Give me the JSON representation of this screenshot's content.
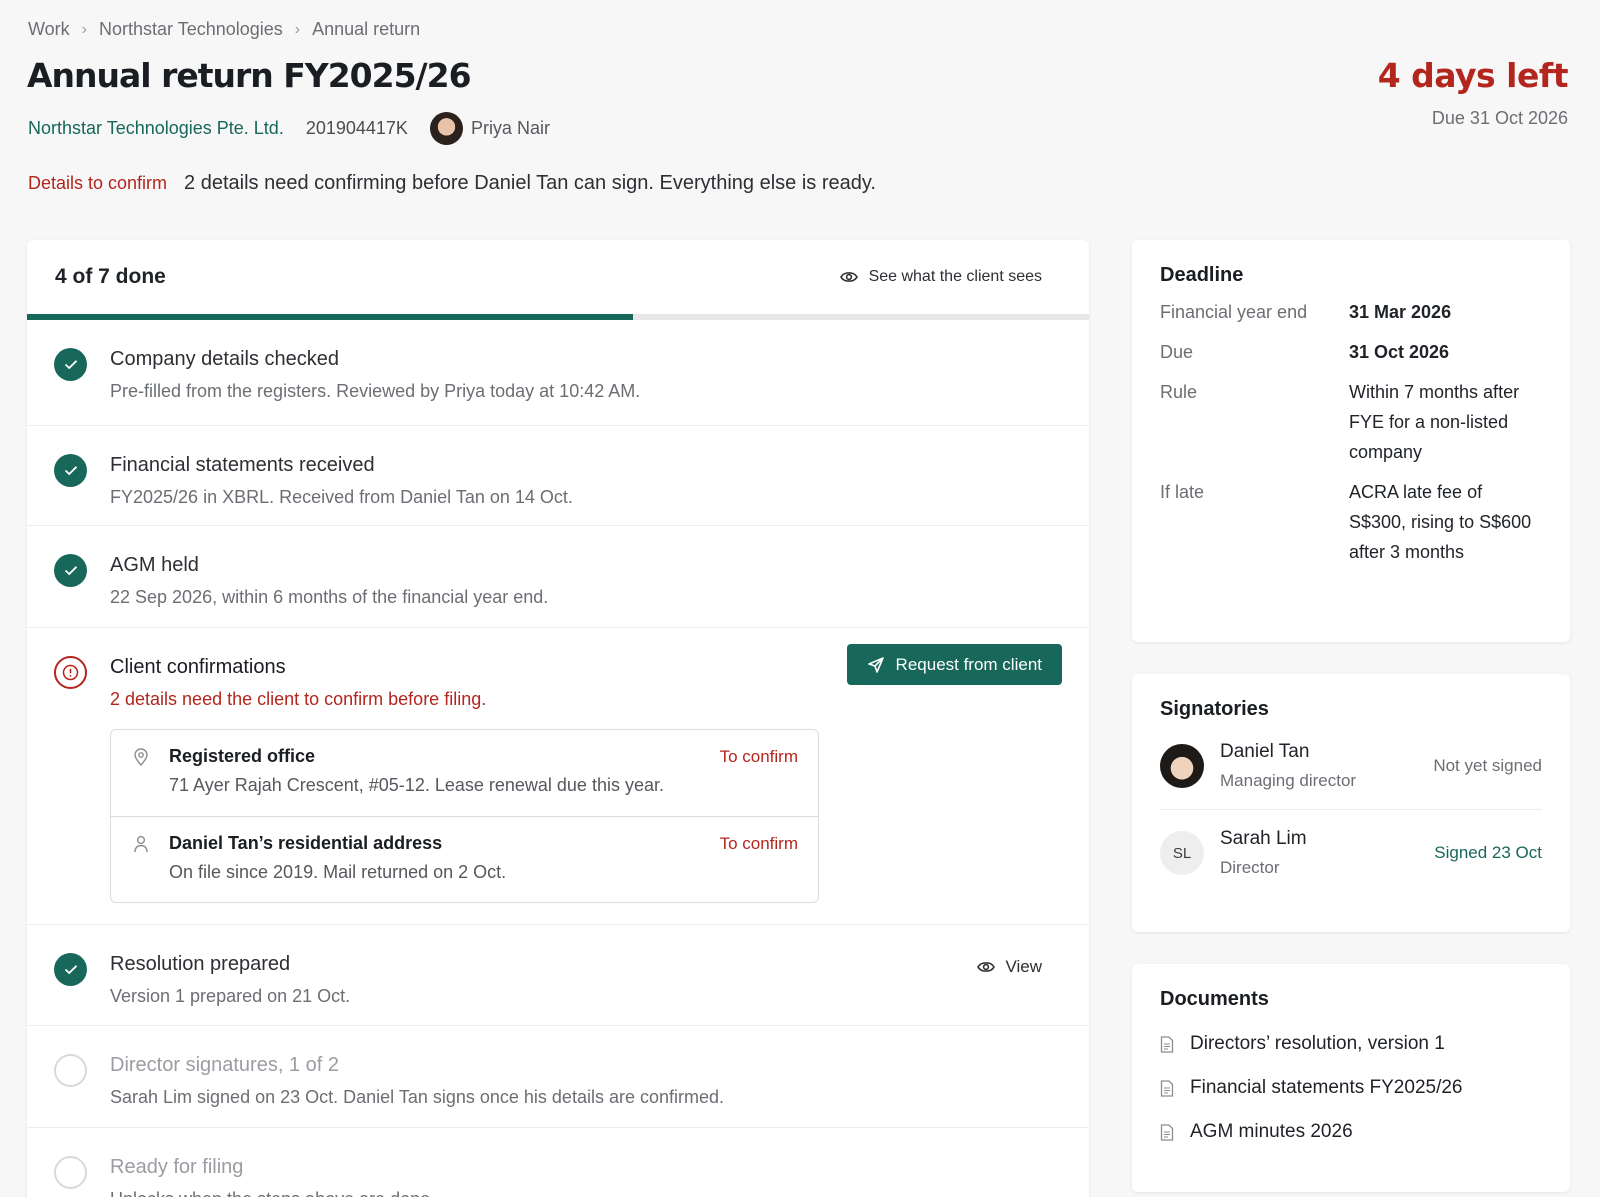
{
  "breadcrumb": [
    "Work",
    "Northstar Technologies",
    "Annual return"
  ],
  "title": "Annual return FY2025/26",
  "company": "Northstar Technologies Pte. Ltd.",
  "uen": "201904417K",
  "owner": "Priya Nair",
  "days_left": "4 days left",
  "due_text": "Due 31 Oct 2026",
  "status": {
    "tag": "Details to confirm",
    "message": "2 details need confirming before Daniel Tan can sign. Everything else is ready."
  },
  "progress": {
    "label": "4 of 7 done",
    "fraction": 0.571,
    "client_view_label": "See what the client sees"
  },
  "steps": {
    "company": {
      "title": "Company details checked",
      "desc": "Pre-filled from the registers. Reviewed by Priya today at 10:42 AM."
    },
    "financials": {
      "title": "Financial statements received",
      "desc": "FY2025/26 in XBRL. Received from Daniel Tan on 14 Oct."
    },
    "agm": {
      "title": "AGM held",
      "desc": "22 Sep 2026, within 6 months of the financial year end."
    },
    "confirmations": {
      "title": "Client confirmations",
      "desc": "2 details need the client to confirm before filing.",
      "button": "Request from client",
      "items": [
        {
          "title": "Registered office",
          "desc": "71 Ayer Rajah Crescent, #05-12. Lease renewal due this year.",
          "status": "To confirm"
        },
        {
          "title": "Daniel Tan’s residential address",
          "desc": "On file since 2019. Mail returned on 2 Oct.",
          "status": "To confirm"
        }
      ]
    },
    "resolution": {
      "title": "Resolution prepared",
      "desc": "Version 1 prepared on 21 Oct.",
      "link": "View"
    },
    "signatures": {
      "title": "Director signatures, 1 of 2",
      "desc": "Sarah Lim signed on 23 Oct. Daniel Tan signs once his details are confirmed."
    },
    "filing": {
      "title": "Ready for filing",
      "desc": "Unlocks when the steps above are done."
    }
  },
  "deadline": {
    "title": "Deadline",
    "rows": [
      {
        "k": "Financial year end",
        "v": "31 Mar 2026"
      },
      {
        "k": "Due",
        "v": "31 Oct 2026"
      },
      {
        "k": "Rule",
        "v": "Within 7 months after FYE for a non-listed company"
      },
      {
        "k": "If late",
        "v": "ACRA late fee of S$300, rising to S$600 after 3 months"
      }
    ]
  },
  "signatories": {
    "title": "Signatories",
    "people": [
      {
        "name": "Daniel Tan",
        "role": "Managing director",
        "status": "Not yet signed"
      },
      {
        "name": "Sarah Lim",
        "initials": "SL",
        "role": "Director",
        "status": "Signed 23 Oct"
      }
    ]
  },
  "documents": {
    "title": "Documents",
    "items": [
      "Directors’ resolution, version 1",
      "Financial statements FY2025/26",
      "AGM minutes 2026"
    ]
  },
  "colors": {
    "accent": "#17675a",
    "danger": "#b3261e"
  }
}
